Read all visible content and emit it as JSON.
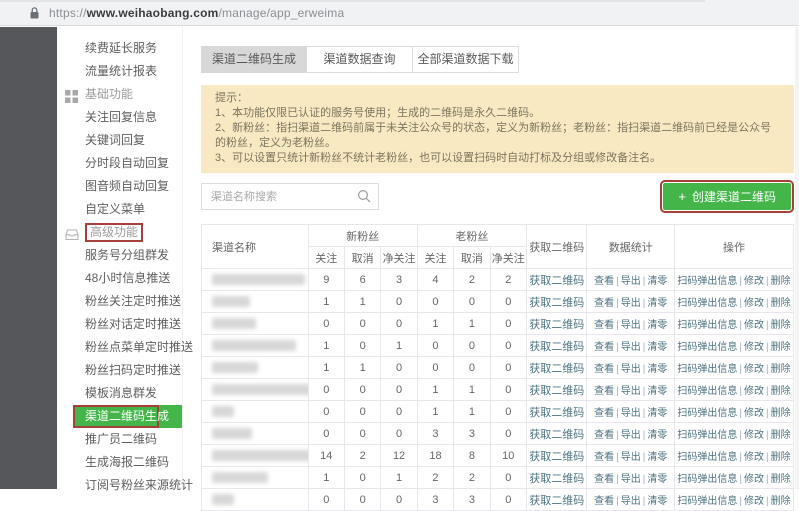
{
  "colors": {
    "accent_green": "#44b549",
    "annotation_red": "#a6413a",
    "link_teal": "#4c7380",
    "notice_bg": "#f9e9c2"
  },
  "browser": {
    "scheme": "https://",
    "host": "www.weihaobang.com",
    "path": "/manage/app_erweima"
  },
  "sidebar": {
    "items": [
      {
        "label": "续费延长服务"
      },
      {
        "label": "流量统计报表"
      },
      {
        "label": "基础功能"
      },
      {
        "label": "关注回复信息"
      },
      {
        "label": "关键词回复"
      },
      {
        "label": "分时段自动回复"
      },
      {
        "label": "图音频自动回复"
      },
      {
        "label": "自定义菜单"
      },
      {
        "label": "高级功能"
      },
      {
        "label": "服务号分组群发"
      },
      {
        "label": "48小时信息推送"
      },
      {
        "label": "粉丝关注定时推送"
      },
      {
        "label": "粉丝对话定时推送"
      },
      {
        "label": "粉丝点菜单定时推送"
      },
      {
        "label": "粉丝扫码定时推送"
      },
      {
        "label": "模板消息群发"
      },
      {
        "label": "渠道二维码生成"
      },
      {
        "label": "推广员二维码"
      },
      {
        "label": "生成海报二维码"
      },
      {
        "label": "订阅号粉丝来源统计"
      }
    ]
  },
  "tabs": [
    {
      "label": "渠道二维码生成"
    },
    {
      "label": "渠道数据查询"
    },
    {
      "label": "全部渠道数据下载"
    }
  ],
  "notice": {
    "title": "提示：",
    "line1": "1、本功能仅限已认证的服务号使用；生成的二维码是永久二维码。",
    "line2": "2、新粉丝：指扫渠道二维码前属于未关注公众号的状态，定义为新粉丝；老粉丝：指扫渠道二维码前已经是公众号的粉丝，定义为老粉丝。",
    "line3": "3、可以设置只统计新粉丝不统计老粉丝，也可以设置扫码时自动打标及分组或修改备注名。"
  },
  "toolbar": {
    "search_placeholder": "渠道名称搜索",
    "create_plus": "+",
    "create_label": "创建渠道二维码"
  },
  "table": {
    "header": {
      "channel": "渠道名称",
      "new_fans": "新粉丝",
      "old_fans": "老粉丝",
      "follow": "关注",
      "cancel": "取消",
      "net_follow": "净关注",
      "get_qr": "获取二维码",
      "stats": "数据统计",
      "actions": "操作"
    },
    "sep": "|",
    "row_links": {
      "get_qr": "获取二维码",
      "view": "查看",
      "export": "导出",
      "clear": "清零",
      "scan_popup": "扫码弹出信息",
      "modify": "修改",
      "del": "删除"
    },
    "rows": [
      {
        "nf": 9,
        "nc": 6,
        "nn": 3,
        "of": 4,
        "oc": 2,
        "on": 2,
        "blur_style": "width:93px"
      },
      {
        "nf": 1,
        "nc": 1,
        "nn": 0,
        "of": 0,
        "oc": 0,
        "on": 0,
        "blur_style": "width:38px"
      },
      {
        "nf": 0,
        "nc": 0,
        "nn": 0,
        "of": 1,
        "oc": 1,
        "on": 0,
        "blur_style": "width:44px"
      },
      {
        "nf": 1,
        "nc": 0,
        "nn": 1,
        "of": 0,
        "oc": 0,
        "on": 0,
        "blur_style": "width:84px"
      },
      {
        "nf": 1,
        "nc": 1,
        "nn": 0,
        "of": 0,
        "oc": 0,
        "on": 0,
        "blur_style": "width:46px"
      },
      {
        "nf": 0,
        "nc": 0,
        "nn": 0,
        "of": 1,
        "oc": 1,
        "on": 0,
        "blur_style": "width:108px"
      },
      {
        "nf": 0,
        "nc": 0,
        "nn": 0,
        "of": 1,
        "oc": 1,
        "on": 0,
        "blur_style": "width:22px"
      },
      {
        "nf": 0,
        "nc": 0,
        "nn": 0,
        "of": 3,
        "oc": 3,
        "on": 0,
        "blur_style": "width:40px"
      },
      {
        "nf": 14,
        "nc": 2,
        "nn": 12,
        "of": 18,
        "oc": 8,
        "on": 10,
        "blur_style": "width:104px"
      },
      {
        "nf": 1,
        "nc": 0,
        "nn": 1,
        "of": 2,
        "oc": 2,
        "on": 0,
        "blur_style": "width:56px"
      },
      {
        "nf": 0,
        "nc": 0,
        "nn": 0,
        "of": 3,
        "oc": 3,
        "on": 0,
        "blur_style": "width:22px"
      }
    ]
  }
}
